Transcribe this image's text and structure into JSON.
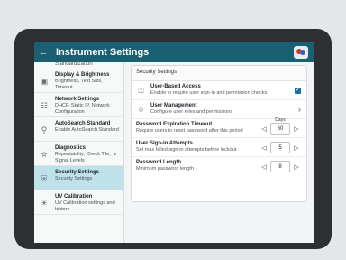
{
  "header": {
    "title": "Instrument Settings"
  },
  "sidebar": {
    "cut_item": "Standardization",
    "items": [
      {
        "title": "Display & Brightness",
        "sub": "Brightness, Text Size, Timeout",
        "icon": "monitor-icon"
      },
      {
        "title": "Network Settings",
        "sub": "DHCP, Static IP, Network Configuration",
        "icon": "network-icon"
      },
      {
        "title": "AutoSearch Standard",
        "sub": "Enable AutoSearch Standard",
        "icon": "search-icon"
      },
      {
        "title": "Diagnostics",
        "sub": "Repeatability, Check Tile, Signal Levels",
        "icon": "stethoscope-icon"
      },
      {
        "title": "Security Settings",
        "sub": "Security Settings",
        "icon": "shield-icon"
      },
      {
        "title": "UV Calibration",
        "sub": "UV Calibration settings and history",
        "icon": "sun-icon"
      }
    ]
  },
  "security": {
    "section_title": "Security Settings",
    "user_access": {
      "title": "User-Based Access",
      "sub": "Enable to require user sign-in and permission checks",
      "checked": true
    },
    "user_mgmt": {
      "title": "User Management",
      "sub": "Configure user roles and permissions"
    },
    "pwd_timeout": {
      "title": "Password Expiration Timeout",
      "sub": "Require users to reset password after this period",
      "value": "60",
      "unit": "Days"
    },
    "signin_attempts": {
      "title": "User Sign-in Attempts",
      "sub": "Set max failed sign-in attempts before lockout",
      "value": "5"
    },
    "pwd_length": {
      "title": "Password Length",
      "sub": "Minimum password length",
      "value": "8"
    }
  }
}
